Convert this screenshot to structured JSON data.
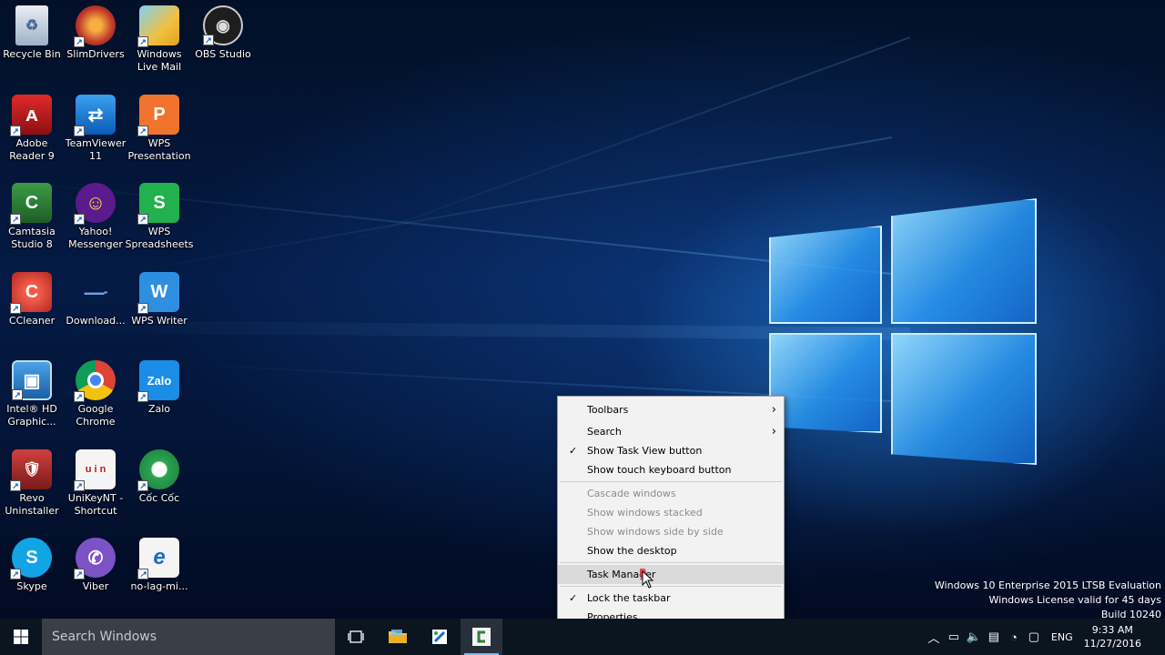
{
  "desktop_icons": [
    {
      "label": "Recycle Bin",
      "color": "#c9d6e6"
    },
    {
      "label": "SlimDrivers",
      "color": "#c0392b"
    },
    {
      "label": "Windows Live Mail",
      "color": "#f0c040"
    },
    {
      "label": "OBS Studio",
      "color": "#1e1e1e"
    },
    {
      "label": "Adobe Reader 9",
      "color": "#c8161d"
    },
    {
      "label": "TeamViewer 11",
      "color": "#0e72d6"
    },
    {
      "label": "WPS Presentation",
      "color": "#f0742e"
    },
    {
      "label": "Camtasia Studio 8",
      "color": "#2f7d3a"
    },
    {
      "label": "Yahoo! Messenger",
      "color": "#5b1b8c"
    },
    {
      "label": "WPS Spreadsheets",
      "color": "#22b14c"
    },
    {
      "label": "CCleaner",
      "color": "#d93025"
    },
    {
      "label": "Download...",
      "color": "#1a2a55"
    },
    {
      "label": "WPS Writer",
      "color": "#2e8fe0"
    },
    {
      "label": "Intel® HD Graphic...",
      "color": "#1f78c8"
    },
    {
      "label": "Google Chrome",
      "color": "#ffffff"
    },
    {
      "label": "Zalo",
      "color": "#1a8de6"
    },
    {
      "label": "Revo Uninstaller",
      "color": "#b03030"
    },
    {
      "label": "UniKeyNT - Shortcut",
      "color": "#f4f4f4"
    },
    {
      "label": "Cốc Cốc",
      "color": "#2aa44f"
    },
    {
      "label": "Skype",
      "color": "#12a5e6"
    },
    {
      "label": "Viber",
      "color": "#7d52c7"
    },
    {
      "label": "no-lag-mi...",
      "color": "#1b6ac9"
    }
  ],
  "context_menu": {
    "items": [
      {
        "label": "Toolbars",
        "submenu": true
      },
      {
        "label": "Search",
        "submenu": true
      },
      {
        "label": "Show Task View button",
        "checked": true
      },
      {
        "label": "Show touch keyboard button"
      },
      {
        "label": "Cascade windows",
        "disabled": true
      },
      {
        "label": "Show windows stacked",
        "disabled": true
      },
      {
        "label": "Show windows side by side",
        "disabled": true
      },
      {
        "label": "Show the desktop"
      },
      {
        "label": "Task Manager"
      },
      {
        "label": "Lock the taskbar",
        "checked": true
      },
      {
        "label": "Properties"
      }
    ]
  },
  "watermark": {
    "line1": "Windows 10 Enterprise 2015 LTSB Evaluation",
    "line2": "Windows License valid for 45 days",
    "line3": "Build 10240"
  },
  "taskbar": {
    "search_placeholder": "Search Windows",
    "language": "ENG",
    "time": "9:33 AM",
    "date": "11/27/2016",
    "accent": "#76b9ed"
  }
}
